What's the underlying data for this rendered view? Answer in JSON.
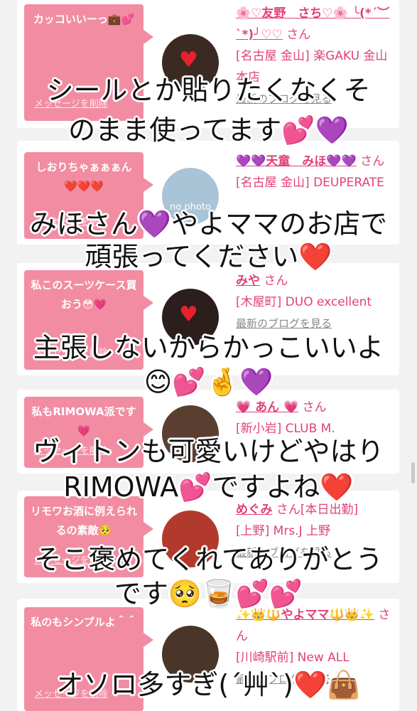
{
  "colors": {
    "accent": "#f28ca2",
    "name_pink": "#e2407a",
    "overlay_text": "#111111"
  },
  "cards": [
    {
      "message": "カッコいいーっ💼💕",
      "delete_label": "メッセージを削除",
      "avatar_icon": "heart-sticker",
      "name": "🌸♡友野　さち♡🌸 ╰(*´︶`*)╯♡♡",
      "san": "さん",
      "shop": "[名古屋 金山] 楽GAKU 金山本店",
      "blog": "最新のブログを見る"
    },
    {
      "message": "しおりちゃぁぁぁん❤️❤️❤️",
      "delete_label": "メッセージを削除",
      "avatar_text": "no photo",
      "name": "💜💜天童　みほ💜💜",
      "san": "さん",
      "shop": "[名古屋 金山] DEUPERATE",
      "blog": "最新のブログを見る"
    },
    {
      "message": "私このスーツケース買おう😳💗",
      "delete_label": "メッセージを削除",
      "avatar_icon": "heart-sticker",
      "name": "みや",
      "san": "さん",
      "shop": "[木屋町] DUO excellent",
      "blog": "最新のブログを見る"
    },
    {
      "message": "私もRIMOWA派です💗",
      "delete_label": "メッセージを削除",
      "name": "💗 あん 💗",
      "san": "さん",
      "shop": "[新小岩] CLUB M.",
      "blog": "最新のブログを見る"
    },
    {
      "message": "リモワお酒に例えられるの素敵🥺",
      "delete_label": "メッセージを削除",
      "name": "めぐみ",
      "san": "さん[本日出勤]",
      "shop": "[上野] Mrs.J 上野",
      "blog": "最新のブログを見る"
    },
    {
      "message": "私のもシンプルよ＾＾",
      "delete_label": "メッセージを削除",
      "name": "✨👑🔱やよママ🔱👑✨",
      "san": "さん",
      "shop": "[川崎駅前] New ALL",
      "blog": "最新のブログを見る"
    }
  ],
  "overlays": [
    "シールとか貼りたくなくそ",
    "のまま使ってます💕💜",
    "みほさん💜やよママのお店で",
    "頑張ってください❤️",
    "主張しないからかっこいいよ",
    "😊💕🤞💜",
    "ヴィトンも可愛いけどやはり",
    "RIMOWA💕ですよね❤️",
    "そこ褒めてくれてありがとう",
    "です🥺🥃💕💕",
    "オソロ多すぎ(´艸`)❤️👜"
  ]
}
